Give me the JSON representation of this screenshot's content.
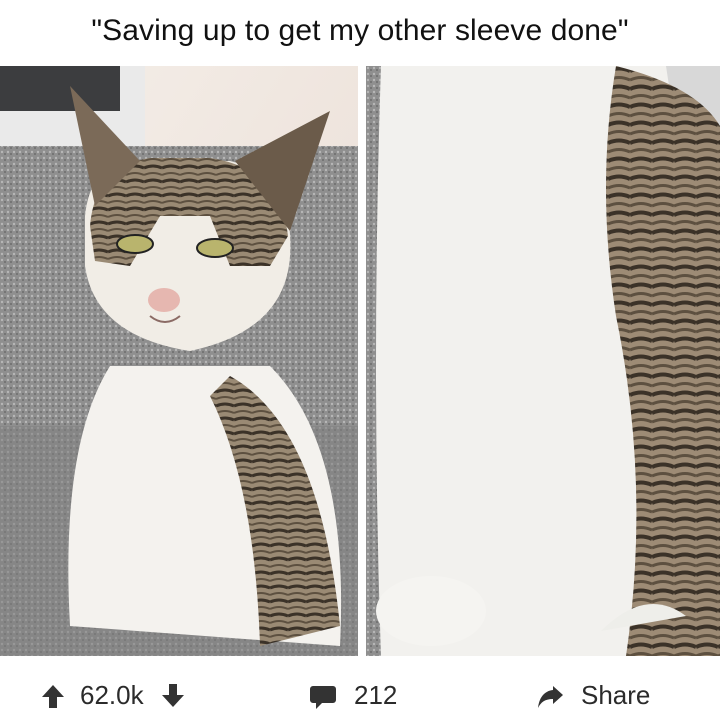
{
  "caption": "\"Saving up to get my other sleeve done\"",
  "images": [
    {
      "description_name": "cat-left"
    },
    {
      "description_name": "cat-right"
    }
  ],
  "actions": {
    "upvote_icon": "arrow-up-icon",
    "vote_count": "62.0k",
    "downvote_icon": "arrow-down-icon",
    "comment_icon": "comment-bubble-icon",
    "comment_count": "212",
    "share_icon": "share-arrow-icon",
    "share_label": "Share"
  },
  "colors": {
    "text": "#1a1a1a",
    "icon": "#333333",
    "background": "#ffffff"
  }
}
